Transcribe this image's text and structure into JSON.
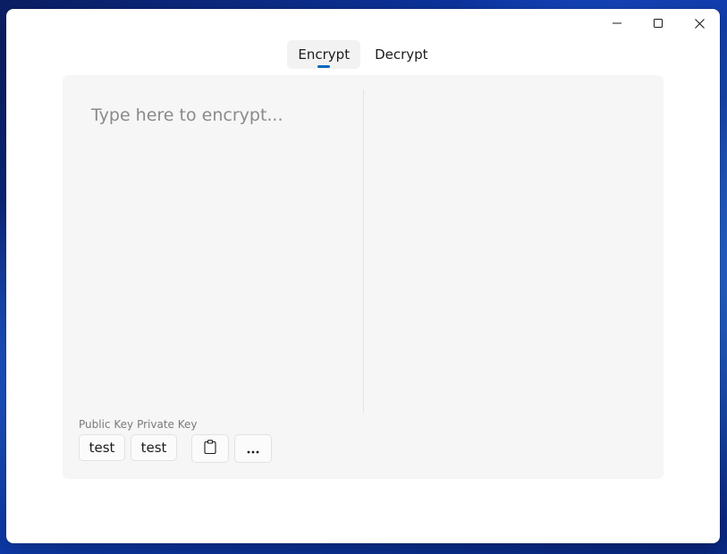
{
  "window": {
    "controls": {
      "minimize_icon": "minimize-icon",
      "maximize_icon": "maximize-icon",
      "close_icon": "close-icon"
    }
  },
  "tabs": [
    {
      "label": "Encrypt",
      "selected": true
    },
    {
      "label": "Decrypt",
      "selected": false
    }
  ],
  "encrypt": {
    "input_placeholder": "Type here to encrypt...",
    "output_text": "",
    "public_key_label": "Public Key",
    "private_key_label": "Private Key",
    "public_key_value": "test",
    "private_key_value": "test",
    "clipboard_icon": "clipboard-icon",
    "more_icon": "more-options-icon"
  },
  "colors": {
    "accent": "#0067c0",
    "panel_bg": "#f6f6f6",
    "window_bg": "#ffffff"
  }
}
